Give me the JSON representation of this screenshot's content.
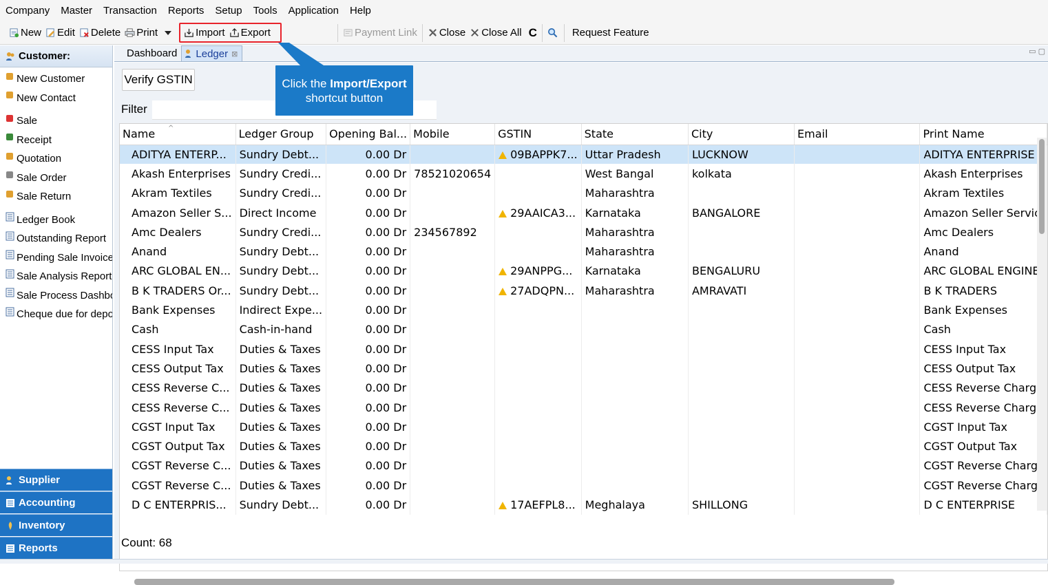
{
  "menu": [
    "Company",
    "Master",
    "Transaction",
    "Reports",
    "Setup",
    "Tools",
    "Application",
    "Help"
  ],
  "toolbar": {
    "new_label": "New",
    "edit_label": "Edit",
    "delete_label": "Delete",
    "print_label": "Print",
    "import_label": "Import",
    "export_label": "Export",
    "payment_link_label": "Payment Link",
    "close_label": "Close",
    "close_all_label": "Close All",
    "refresh_glyph": "C",
    "request_feature_label": "Request Feature"
  },
  "sidebar": {
    "header": "Customer:",
    "items": [
      {
        "label": "New Customer",
        "icon": "customer-icon"
      },
      {
        "label": "New Contact",
        "icon": "contact-icon"
      },
      {
        "label": "Sale",
        "icon": "sale-icon"
      },
      {
        "label": "Receipt",
        "icon": "receipt-icon"
      },
      {
        "label": "Quotation",
        "icon": "quotation-icon"
      },
      {
        "label": "Sale Order",
        "icon": "sale-order-icon"
      },
      {
        "label": "Sale Return",
        "icon": "sale-return-icon"
      },
      {
        "label": "Ledger Book",
        "icon": "report-icon"
      },
      {
        "label": "Outstanding Report",
        "icon": "report-icon"
      },
      {
        "label": "Pending Sale Invoices",
        "icon": "report-icon"
      },
      {
        "label": "Sale Analysis Report",
        "icon": "report-icon"
      },
      {
        "label": "Sale Process Dashboa",
        "icon": "report-icon"
      },
      {
        "label": "Cheque due for depos",
        "icon": "report-icon"
      }
    ],
    "sections": [
      "Supplier",
      "Accounting",
      "Inventory",
      "Reports"
    ]
  },
  "tabs": [
    {
      "label": "Dashboard",
      "active": false
    },
    {
      "label": "Ledger",
      "active": true
    }
  ],
  "main": {
    "verify_gstin_label": "Verify GSTIN",
    "filter_label": "Filter",
    "filter_value": "",
    "count_label": "Count: 68"
  },
  "table": {
    "columns": [
      "Name",
      "Ledger Group",
      "Opening Bal...",
      "Mobile",
      "GSTIN",
      "State",
      "City",
      "Email",
      "Print Name"
    ],
    "rows": [
      [
        "ADITYA ENTERP...",
        "Sundry Debt...",
        "0.00 Dr",
        "",
        "09BAPPK7...",
        "Uttar Pradesh",
        "LUCKNOW",
        "",
        "ADITYA ENTERPRISE"
      ],
      [
        "Akash Enterprises",
        "Sundry Credi...",
        "0.00 Dr",
        "78521020654",
        "",
        "West Bangal",
        "kolkata",
        "",
        "Akash Enterprises"
      ],
      [
        "Akram Textiles",
        "Sundry Credi...",
        "0.00 Dr",
        "",
        "",
        "Maharashtra",
        "",
        "",
        "Akram Textiles"
      ],
      [
        "Amazon Seller S...",
        "Direct Income",
        "0.00 Dr",
        "",
        "29AAICA3...",
        "Karnataka",
        "BANGALORE",
        "",
        "Amazon Seller Servic"
      ],
      [
        "Amc Dealers",
        "Sundry Credi...",
        "0.00 Dr",
        "234567892",
        "",
        "Maharashtra",
        "",
        "",
        "Amc Dealers"
      ],
      [
        "Anand",
        "Sundry Debt...",
        "0.00 Dr",
        "",
        "",
        "Maharashtra",
        "",
        "",
        "Anand"
      ],
      [
        "ARC GLOBAL EN...",
        "Sundry Debt...",
        "0.00 Dr",
        "",
        "29ANPPG...",
        "Karnataka",
        "BENGALURU",
        "",
        "ARC GLOBAL ENGINE"
      ],
      [
        "B K TRADERS Or...",
        "Sundry Debt...",
        "0.00 Dr",
        "",
        "27ADQPN...",
        "Maharashtra",
        "AMRAVATI",
        "",
        "B K TRADERS"
      ],
      [
        "Bank Expenses",
        "Indirect Expe...",
        "0.00 Dr",
        "",
        "",
        "",
        "",
        "",
        "Bank Expenses"
      ],
      [
        "Cash",
        "Cash-in-hand",
        "0.00 Dr",
        "",
        "",
        "",
        "",
        "",
        "Cash"
      ],
      [
        "CESS Input Tax",
        "Duties & Taxes",
        "0.00 Dr",
        "",
        "",
        "",
        "",
        "",
        "CESS Input Tax"
      ],
      [
        "CESS Output Tax",
        "Duties & Taxes",
        "0.00 Dr",
        "",
        "",
        "",
        "",
        "",
        "CESS Output Tax"
      ],
      [
        "CESS Reverse C...",
        "Duties & Taxes",
        "0.00 Dr",
        "",
        "",
        "",
        "",
        "",
        "CESS Reverse Charge"
      ],
      [
        "CESS Reverse C...",
        "Duties & Taxes",
        "0.00 Dr",
        "",
        "",
        "",
        "",
        "",
        "CESS Reverse Charge"
      ],
      [
        "CGST Input Tax",
        "Duties & Taxes",
        "0.00 Dr",
        "",
        "",
        "",
        "",
        "",
        "CGST Input Tax"
      ],
      [
        "CGST Output Tax",
        "Duties & Taxes",
        "0.00 Dr",
        "",
        "",
        "",
        "",
        "",
        "CGST Output Tax"
      ],
      [
        "CGST Reverse C...",
        "Duties & Taxes",
        "0.00 Dr",
        "",
        "",
        "",
        "",
        "",
        "CGST Reverse Charg"
      ],
      [
        "CGST Reverse C...",
        "Duties & Taxes",
        "0.00 Dr",
        "",
        "",
        "",
        "",
        "",
        "CGST Reverse Charg"
      ],
      [
        "D C ENTERPRIS...",
        "Sundry Debt...",
        "0.00 Dr",
        "",
        "17AEFPL8...",
        "Meghalaya",
        "SHILLONG",
        "",
        "D C ENTERPRISE"
      ]
    ],
    "selected_row": 0
  },
  "callout": {
    "line1_prefix": "Click the ",
    "line1_bold": "Import/Export",
    "line2": "shortcut button"
  },
  "colors": {
    "accent": "#1e73c4",
    "callout": "#1b7ac8",
    "highlight": "#e8232b",
    "selected_row": "#cde4f8",
    "warning": "#f0b400"
  }
}
